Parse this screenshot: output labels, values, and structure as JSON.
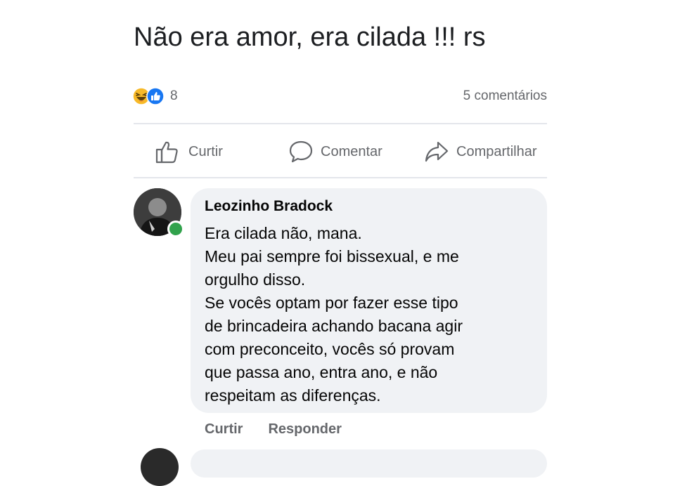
{
  "post": {
    "text": "Não era amor, era cilada !!! rs",
    "reactions": {
      "icons": [
        "haha-icon",
        "like-reaction-icon"
      ],
      "count": "8"
    },
    "comments_count": "5 comentários"
  },
  "actions": {
    "like": "Curtir",
    "comment": "Comentar",
    "share": "Compartilhar"
  },
  "comment": {
    "author": "Leozinho Bradock",
    "lines": [
      "Era cilada não, mana.",
      "Meu pai sempre foi bissexual, e me",
      "orgulho disso.",
      "Se vocês optam por fazer esse tipo",
      "de brincadeira achando bacana agir",
      "com preconceito, vocês só provam",
      "que passa ano, entra ano, e não",
      "respeitam as diferenças."
    ],
    "actions": {
      "like": "Curtir",
      "reply": "Responder"
    },
    "online": true
  },
  "colors": {
    "like_blue": "#1877f2",
    "haha_yellow": "#f7b928",
    "online_green": "#31a24c",
    "secondary_text": "#65676b",
    "bubble_bg": "#f0f2f5"
  }
}
